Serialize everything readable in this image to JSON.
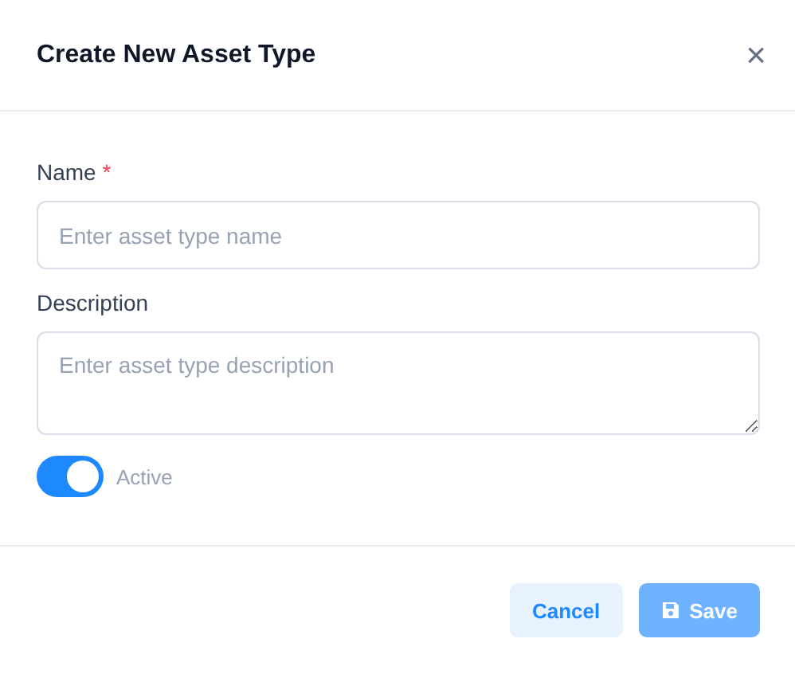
{
  "dialog": {
    "title": "Create New Asset Type",
    "close": "×"
  },
  "fields": [
    {
      "kind": "input",
      "label": "Name",
      "required_mark": "*",
      "placeholder": "Enter asset type name"
    },
    {
      "kind": "textarea",
      "label": "Description",
      "placeholder": "Enter asset type description"
    }
  ],
  "toggle": {
    "label": "Active",
    "on": true
  },
  "buttons": [
    {
      "kind": "secondary",
      "label": "Cancel",
      "disabled": false
    },
    {
      "kind": "primary",
      "label": "Save",
      "disabled": true
    }
  ]
}
